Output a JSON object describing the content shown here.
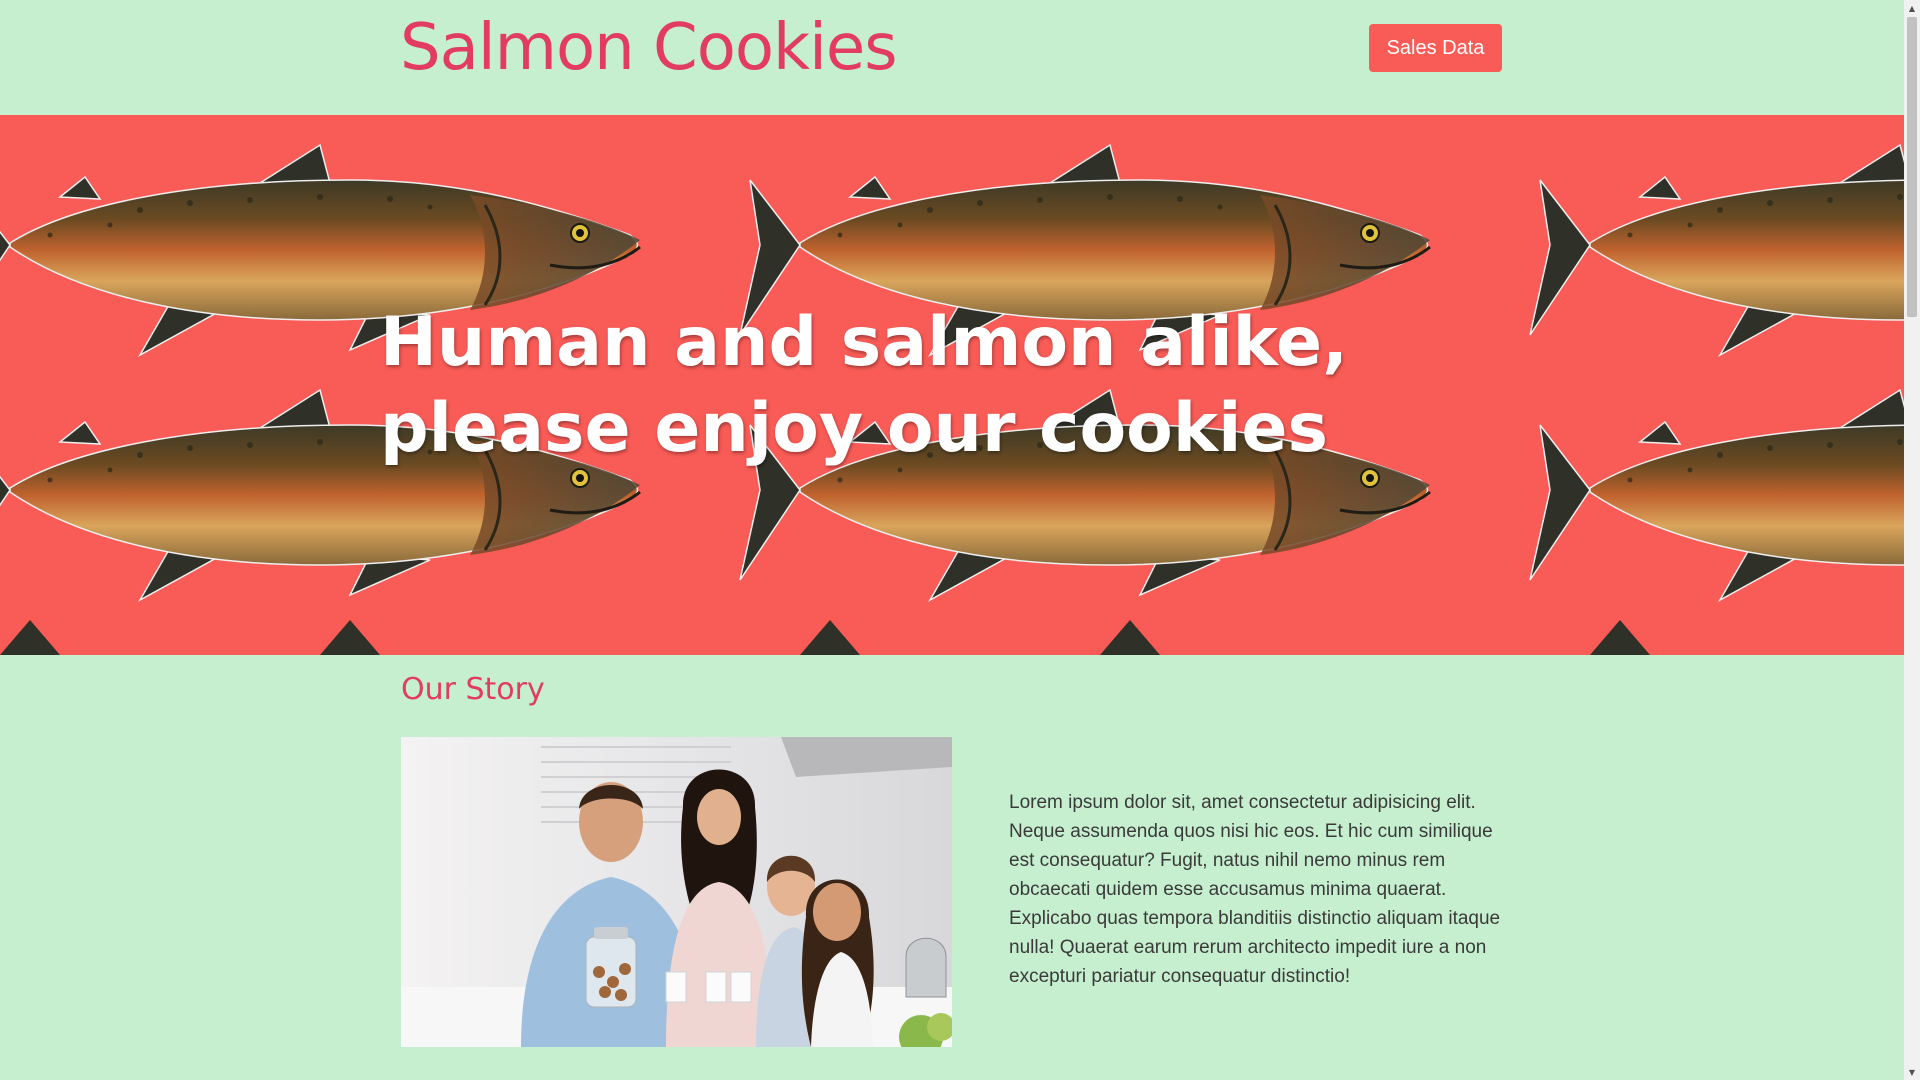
{
  "header": {
    "title": "Salmon Cookies",
    "nav_button": "Sales Data"
  },
  "hero": {
    "line1": "Human and salmon alike,",
    "line2": "please enjoy our cookies"
  },
  "story": {
    "heading": "Our Story",
    "body": "Lorem ipsum dolor sit, amet consectetur adipisicing elit. Neque assumenda quos nisi hic eos. Et hic cum similique est consequatur? Fugit, natus nihil nemo minus rem obcaecati quidem esse accusamus minima quaerat. Explicabo quas tempora blanditiis distinctio aliquam itaque nulla! Quaerat earum rerum architecto impedit iure a non excepturi pariatur consequatur distinctio!"
  },
  "scrollbar": {
    "up_glyph": "▲",
    "down_glyph": "▼"
  },
  "colors": {
    "page_background": "#c6efcf",
    "accent_pink": "#e23c62",
    "coral": "#f95b56",
    "white": "#ffffff"
  },
  "icons": [
    "salmon-pattern-image",
    "family-photo-image"
  ]
}
